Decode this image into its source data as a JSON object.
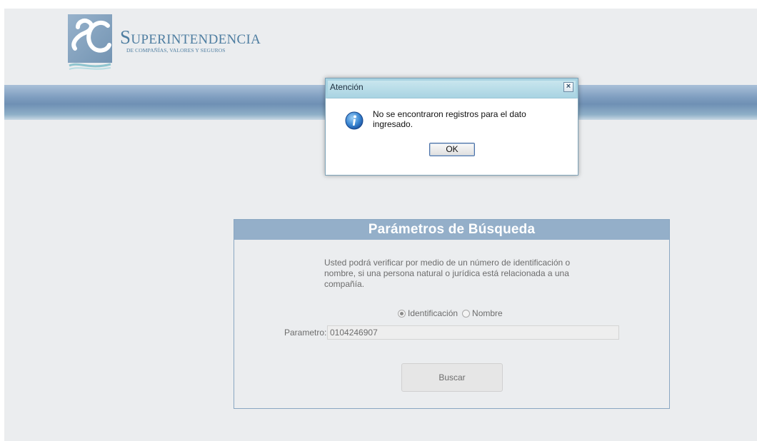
{
  "header": {
    "brand_title": "SUPERINTENDENCIA",
    "brand_subtitle": "DE COMPAÑÍAS, VALORES Y SEGUROS"
  },
  "search_panel": {
    "title": "Parámetros de Búsqueda",
    "description": "Usted podrá verificar por medio de un número de identificación o nombre, si una persona natural o jurídica está relacionada a una compañía.",
    "radio_options": [
      {
        "label": "Identificación",
        "selected": true
      },
      {
        "label": "Nombre",
        "selected": false
      }
    ],
    "param_label": "Parametro:",
    "param_value": "0104246907",
    "search_button": "Buscar"
  },
  "dialog": {
    "title": "Atención",
    "close_label": "×",
    "message": "No se encontraron registros para el dato ingresado.",
    "ok_label": "OK"
  },
  "colors": {
    "page_bg": "#ebedef",
    "panel_header": "#94afc9",
    "brand": "#4f7ea1",
    "dialog_titlebar": "#a8d3e2"
  }
}
